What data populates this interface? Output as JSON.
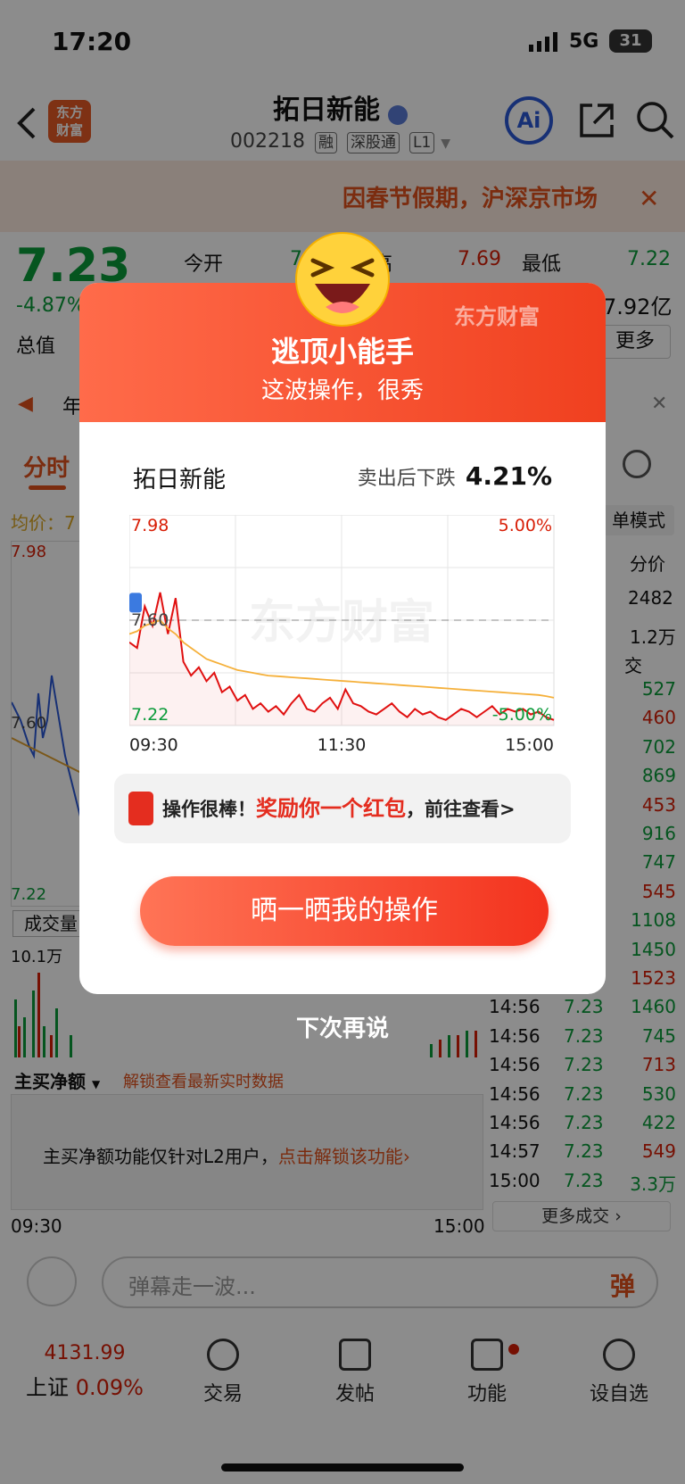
{
  "status_bar": {
    "time": "17:20",
    "network": "5G",
    "battery": "31"
  },
  "header": {
    "name": "拓日新能",
    "code": "002218",
    "tags": [
      "融",
      "深股通",
      "L1"
    ],
    "logo_text": "东方\n财富",
    "ai_label": "Ai"
  },
  "notice": {
    "text": "因春节假期，沪深京市场"
  },
  "quote": {
    "price": "7.23",
    "change_pct": "-4.87%",
    "labels": {
      "open": "今开",
      "high": "高",
      "low": "最低",
      "total": "总值",
      "more": "更多"
    },
    "high_value": "7.69",
    "low_value": "7.22",
    "market_cap": "7.92亿",
    "ticker_prefix": "年",
    "open_value": "7"
  },
  "bg_chart": {
    "tab": "分时",
    "avg_label": "均价：7",
    "top": "7.98",
    "mid": "7.60",
    "bottom": "7.22",
    "volume_label": "成交量",
    "volume_max": "10.1万",
    "t_start": "09:30",
    "t_end": "15:00",
    "net_label": "主买净额",
    "unlock_link": "解锁查看最新实时数据",
    "l2_note": "主买净额功能仅针对L2用户，",
    "l2_link": "点击解锁该功能"
  },
  "side_panel": {
    "mode": "单模式",
    "header_price": "分价",
    "v1": "2482",
    "v2": "1.2万",
    "trades_label": "交",
    "trades": [
      {
        "time": "",
        "price": "",
        "vol": "527"
      },
      {
        "time": "",
        "price": "",
        "vol": "460"
      },
      {
        "time": "",
        "price": "",
        "vol": "702"
      },
      {
        "time": "",
        "price": "",
        "vol": "869"
      },
      {
        "time": "",
        "price": "",
        "vol": "453"
      },
      {
        "time": "",
        "price": "",
        "vol": "916"
      },
      {
        "time": "",
        "price": "",
        "vol": "747"
      },
      {
        "time": "",
        "price": "",
        "vol": "545"
      },
      {
        "time": "",
        "price": "",
        "vol": "1108"
      },
      {
        "time": "",
        "price": "",
        "vol": "1450"
      },
      {
        "time": "",
        "price": "",
        "vol": "1523"
      },
      {
        "time": "14:56",
        "price": "7.23",
        "vol": "1460"
      },
      {
        "time": "14:56",
        "price": "7.23",
        "vol": "745"
      },
      {
        "time": "14:56",
        "price": "7.23",
        "vol": "713"
      },
      {
        "time": "14:56",
        "price": "7.23",
        "vol": "530"
      },
      {
        "time": "14:56",
        "price": "7.23",
        "vol": "422"
      },
      {
        "time": "14:57",
        "price": "7.23",
        "vol": "549"
      },
      {
        "time": "15:00",
        "price": "7.23",
        "vol": "3.3万"
      }
    ],
    "more_trades": "更多成交"
  },
  "danmu": {
    "placeholder": "弹幕走一波...",
    "button": "弹"
  },
  "bottom_nav": {
    "index_value": "4131.99",
    "index_name": "上证",
    "index_change": "0.09%",
    "tabs": [
      "交易",
      "发帖",
      "功能",
      "设自选"
    ]
  },
  "modal": {
    "title": "逃顶小能手",
    "subtitle": "这波操作，很秀",
    "brand": "东方财富",
    "stock_name": "拓日新能",
    "drop_label": "卖出后下跌",
    "drop_value": "4.21%",
    "reward_prefix": "操作很棒！",
    "reward_highlight": "奖励你一个红包",
    "reward_suffix": "，前往查看>",
    "share_button": "晒一晒我的操作",
    "dismiss": "下次再说",
    "watermark": "东方财富"
  },
  "chart_data": {
    "type": "line",
    "x_ticks": [
      "09:30",
      "11:30",
      "15:00"
    ],
    "y_left_labels": [
      "7.98",
      "7.60",
      "7.22"
    ],
    "y_right_labels": [
      "5.00%",
      "-5.00%"
    ],
    "ylim": [
      7.22,
      7.98
    ],
    "reference": 7.6,
    "series": [
      {
        "values": [
          7.52,
          7.5,
          7.65,
          7.58,
          7.7,
          7.55,
          7.68,
          7.45,
          7.4,
          7.43,
          7.38,
          7.41,
          7.34,
          7.36,
          7.31,
          7.33,
          7.28,
          7.3,
          7.27,
          7.29,
          7.26,
          7.3,
          7.33,
          7.28,
          7.27,
          7.3,
          7.32,
          7.28,
          7.35,
          7.3,
          7.29,
          7.27,
          7.26,
          7.28,
          7.3,
          7.27,
          7.25,
          7.28,
          7.26,
          7.27,
          7.25,
          7.24,
          7.26,
          7.28,
          7.27,
          7.25,
          7.27,
          7.29,
          7.26,
          7.28,
          7.27,
          7.28,
          7.26,
          7.27,
          7.25,
          7.24
        ]
      },
      {
        "values": [
          7.55,
          7.56,
          7.58,
          7.59,
          7.6,
          7.57,
          7.55,
          7.52,
          7.5,
          7.48,
          7.46,
          7.45,
          7.44,
          7.43,
          7.42,
          7.415,
          7.41,
          7.405,
          7.4,
          7.398,
          7.396,
          7.394,
          7.392,
          7.39,
          7.388,
          7.386,
          7.384,
          7.382,
          7.38,
          7.378,
          7.376,
          7.374,
          7.372,
          7.37,
          7.368,
          7.366,
          7.364,
          7.362,
          7.36,
          7.358,
          7.356,
          7.354,
          7.352,
          7.35,
          7.348,
          7.346,
          7.344,
          7.342,
          7.34,
          7.338,
          7.336,
          7.334,
          7.332,
          7.33,
          7.326,
          7.32
        ]
      }
    ],
    "colors": [
      "#e01010",
      "#f5b03a"
    ],
    "grid": true
  }
}
